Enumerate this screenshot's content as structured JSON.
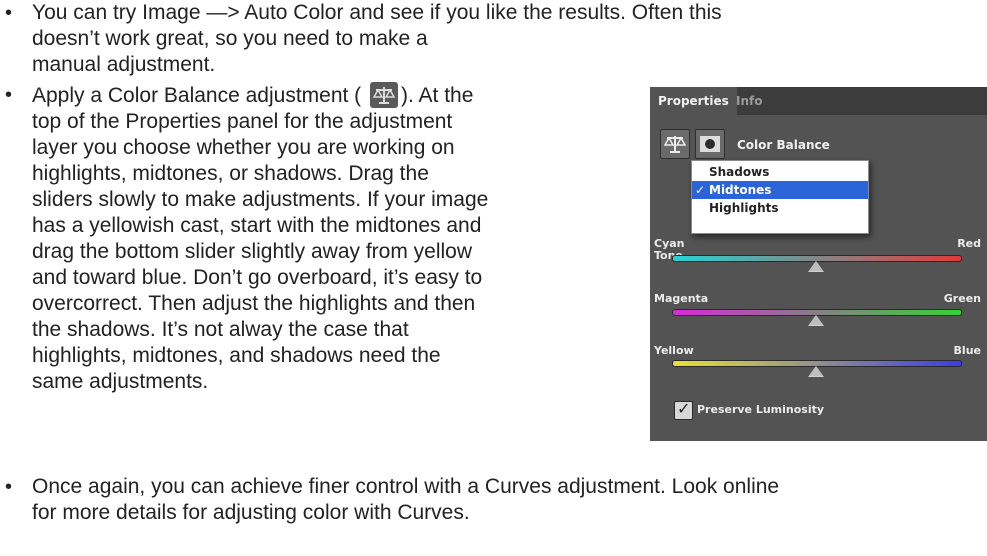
{
  "bullets": [
    {
      "marker": "•",
      "lines": [
        "You can try Image —> Auto Color and see if you like the results. Often this",
        "doesn’t work great, so you need to make a",
        "manual adjustment."
      ]
    },
    {
      "marker": "•",
      "first_line_before": "Apply a Color Balance adjustment (",
      "first_line_after": "). At the",
      "icon": "color-balance-scale-icon",
      "lines": [
        "top of the Properties panel for the adjustment",
        "layer you choose whether you are working on",
        "highlights, midtones, or shadows. Drag the",
        "sliders slowly to make adjustments. If your image",
        "has a yellowish cast, start with the midtones and",
        "drag the bottom slider slightly away from yellow",
        "and toward blue. Don’t go overboard, it’s easy to",
        "overcorrect. Then adjust the highlights and then",
        "the shadows. It’s not alway the case that",
        "highlights, midtones, and shadows need the",
        "same adjustments."
      ]
    },
    {
      "marker": "•",
      "lines": [
        "Once again, you can achieve finer control with a Curves adjustment. Look online",
        "for more details for adjusting color with Curves."
      ]
    }
  ],
  "panel": {
    "tabs": [
      "Properties",
      "Info"
    ],
    "title": "Color Balance",
    "tone_label": "Tone",
    "tone_options": [
      "Shadows",
      "Midtones",
      "Highlights"
    ],
    "tone_selected": "Midtones",
    "check_glyph": "✓",
    "sliders": [
      {
        "left": "Cyan",
        "right": "Red",
        "value": 0.5,
        "colors": [
          "#26d4d4",
          "#e03a3a"
        ]
      },
      {
        "left": "Magenta",
        "right": "Green",
        "value": 0.5,
        "colors": [
          "#d82ad8",
          "#35d335"
        ]
      },
      {
        "left": "Yellow",
        "right": "Blue",
        "value": 0.5,
        "colors": [
          "#e8e233",
          "#3c3ce8"
        ]
      }
    ],
    "preserve_luminosity_label": "Preserve Luminosity",
    "preserve_luminosity_checked": true
  }
}
